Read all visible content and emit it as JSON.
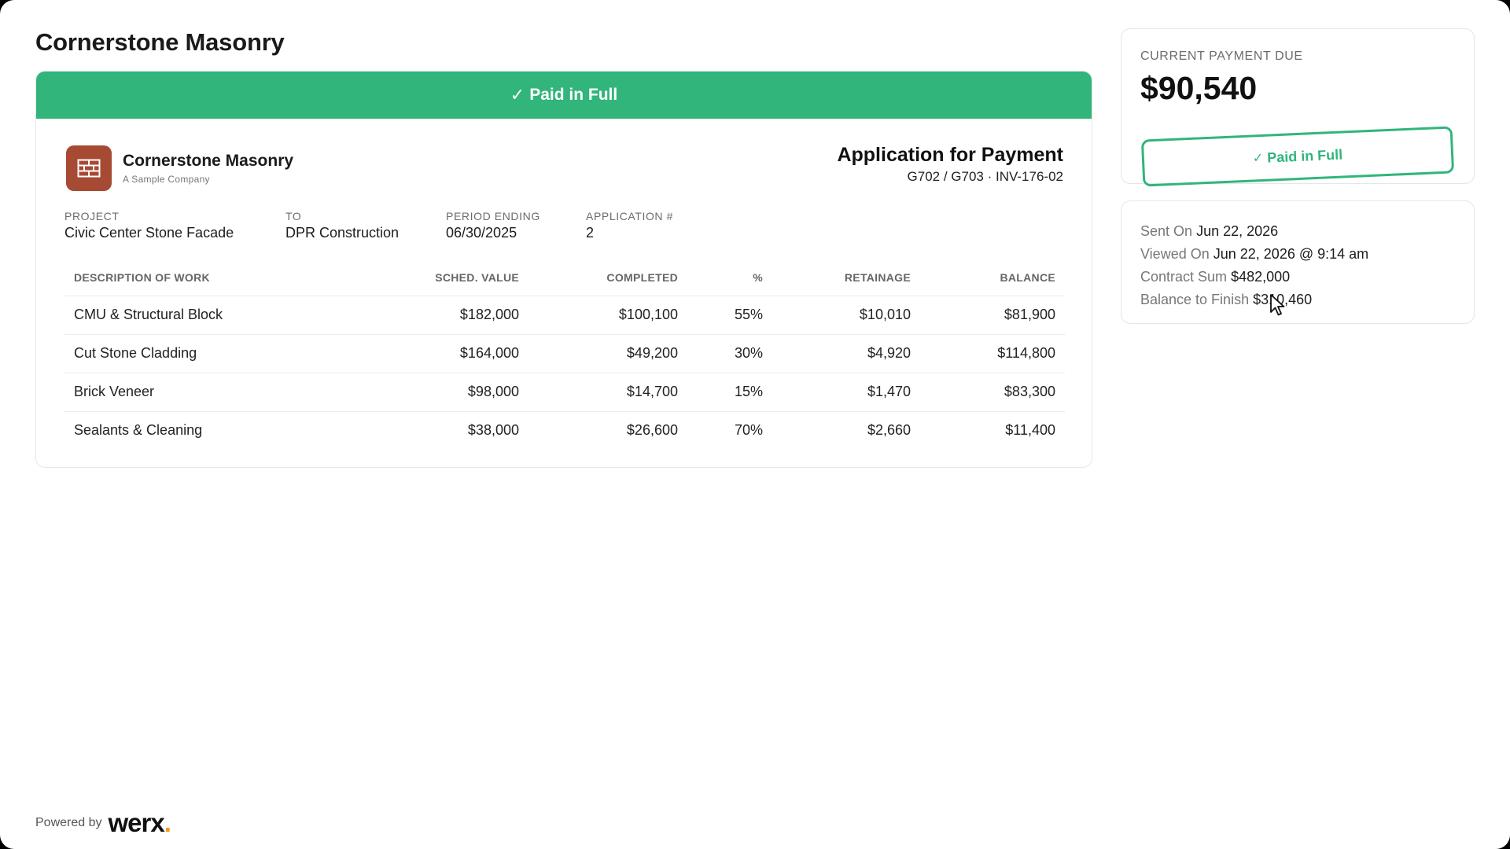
{
  "page_title": "Cornerstone Masonry",
  "banner": {
    "check": "✓",
    "label": "Paid in Full"
  },
  "company": {
    "name": "Cornerstone Masonry",
    "subtitle": "A Sample Company"
  },
  "application": {
    "title": "Application for Payment",
    "subtitle": "G702 / G703 · INV-176-02"
  },
  "meta": [
    {
      "label": "PROJECT",
      "value": "Civic Center Stone Facade"
    },
    {
      "label": "TO",
      "value": "DPR Construction"
    },
    {
      "label": "PERIOD ENDING",
      "value": "06/30/2025"
    },
    {
      "label": "APPLICATION #",
      "value": "2"
    }
  ],
  "table": {
    "headers": [
      "DESCRIPTION OF WORK",
      "SCHED. VALUE",
      "COMPLETED",
      "%",
      "RETAINAGE",
      "BALANCE"
    ],
    "rows": [
      [
        "CMU & Structural Block",
        "$182,000",
        "$100,100",
        "55%",
        "$10,010",
        "$81,900"
      ],
      [
        "Cut Stone Cladding",
        "$164,000",
        "$49,200",
        "30%",
        "$4,920",
        "$114,800"
      ],
      [
        "Brick Veneer",
        "$98,000",
        "$14,700",
        "15%",
        "$1,470",
        "$83,300"
      ],
      [
        "Sealants & Cleaning",
        "$38,000",
        "$26,600",
        "70%",
        "$2,660",
        "$11,400"
      ]
    ]
  },
  "payment": {
    "label": "CURRENT PAYMENT DUE",
    "amount": "$90,540",
    "stamp_check": "✓",
    "stamp_label": "Paid in Full"
  },
  "info": [
    {
      "key": "Sent On",
      "value": "Jun 22, 2026"
    },
    {
      "key": "Viewed On",
      "value": "Jun 22, 2026 @ 9:14 am"
    },
    {
      "key": "Contract Sum",
      "value": "$482,000"
    },
    {
      "key": "Balance to Finish",
      "value": "$310,460"
    }
  ],
  "footer": {
    "powered_label": "Powered by",
    "brand": "werx",
    "brand_dot": "."
  },
  "colors": {
    "accent_green": "#31b57b",
    "logo_brown": "#a64a33",
    "brand_dot": "#f29a1a"
  }
}
